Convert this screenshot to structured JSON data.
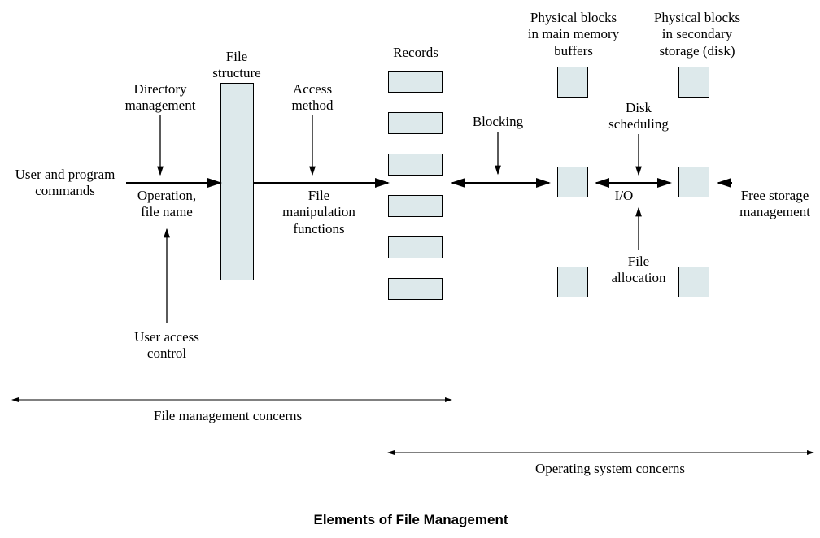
{
  "labels": {
    "user_program_commands": "User and program\ncommands",
    "directory_management": "Directory\nmanagement",
    "file_structure": "File\nstructure",
    "access_method": "Access\nmethod",
    "operation_filename": "Operation,\nfile name",
    "file_manip": "File\nmanipulation\nfunctions",
    "user_access_control": "User access\ncontrol",
    "records": "Records",
    "blocking": "Blocking",
    "physical_main": "Physical blocks\nin main memory\nbuffers",
    "physical_disk": "Physical blocks\nin secondary\nstorage (disk)",
    "disk_scheduling": "Disk\nscheduling",
    "io": "I/O",
    "file_allocation": "File\nallocation",
    "free_storage": "Free storage\nmanagement",
    "fm_concerns": "File management concerns",
    "os_concerns": "Operating system concerns",
    "caption": "Elements of File Management"
  }
}
